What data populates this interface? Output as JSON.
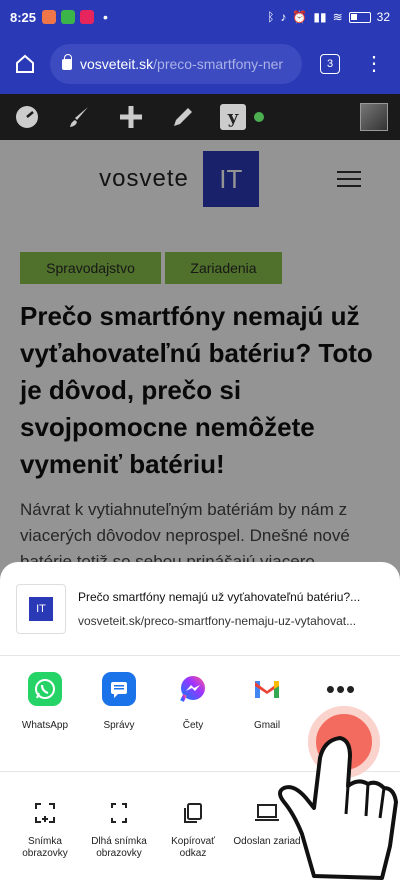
{
  "status_bar": {
    "time": "8:25",
    "battery": "32"
  },
  "browser": {
    "url_domain": "vosveteit.sk",
    "url_path": "/preco-smartfony-ner",
    "tab_count": "3"
  },
  "site": {
    "logo_text": "vosvete",
    "logo_box": "IT"
  },
  "article": {
    "categories": [
      "Spravodajstvo",
      "Zariadenia"
    ],
    "title": "Prečo smartfóny nemajú už vyťahovateľnú batériu? Toto je dôvod, prečo si svojpomocne nemôžete vymeniť batériu!",
    "excerpt": "Návrat k vytiahnuteľným batériám by nám z viacerých dôvodov neprospel. Dnešné nové batérie totiž so sebou prinášajú viacero"
  },
  "share": {
    "preview_thumb": "IT",
    "preview_title": "Prečo smartfóny nemajú už vyťahovateľnú batériu?...",
    "preview_url": "vosveteit.sk/preco-smartfony-nemaju-uz-vytahovat...",
    "apps": [
      {
        "label": "WhatsApp",
        "icon": "whatsapp-icon"
      },
      {
        "label": "Správy",
        "icon": "messages-icon"
      },
      {
        "label": "Čety",
        "icon": "messenger-icon"
      },
      {
        "label": "Gmail",
        "icon": "gmail-icon"
      },
      {
        "label": "",
        "icon": "more-icon"
      }
    ],
    "actions": [
      {
        "label": "Snímka obrazovky",
        "icon": "screenshot-icon"
      },
      {
        "label": "Dlhá snímka obrazovky",
        "icon": "long-screenshot-icon"
      },
      {
        "label": "Kopírovať odkaz",
        "icon": "copy-icon"
      },
      {
        "label": "Odoslan zariad",
        "icon": "send-to-device-icon"
      }
    ]
  },
  "colors": {
    "brand": "#2a3ab6",
    "category": "#8bc34a",
    "tap": "#f36b5e"
  }
}
